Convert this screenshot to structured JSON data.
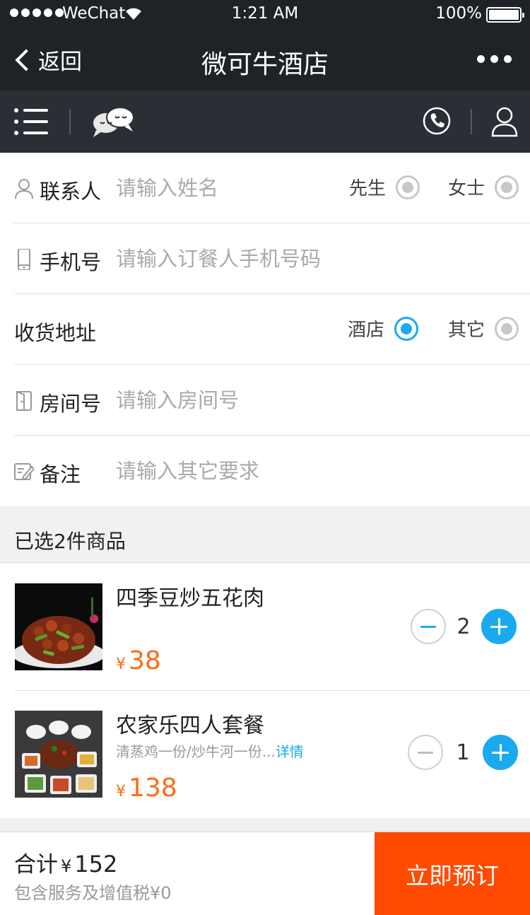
{
  "status_bar": {
    "carrier": "WeChat",
    "time": "1:21 AM",
    "battery": "100%"
  },
  "nav": {
    "back_label": "返回",
    "title": "微可牛酒店"
  },
  "form": {
    "contact": {
      "label": "联系人",
      "placeholder": "请输入姓名",
      "options": [
        "先生",
        "女士"
      ]
    },
    "phone": {
      "label": "手机号",
      "placeholder": "请输入订餐人手机号码"
    },
    "address": {
      "label": "收货地址",
      "options": [
        "酒店",
        "其它"
      ],
      "selected": "酒店"
    },
    "room": {
      "label": "房间号",
      "placeholder": "请输入房间号"
    },
    "note": {
      "label": "备注",
      "placeholder": "请输入其它要求"
    }
  },
  "selected_header": "已选2件商品",
  "items": [
    {
      "name": "四季豆炒五花肉",
      "desc": "",
      "desc_more": "",
      "currency": "¥",
      "price": "38",
      "qty": "2"
    },
    {
      "name": "农家乐四人套餐",
      "desc": "清蒸鸡一份/炒牛河一份...",
      "desc_more": "详情",
      "currency": "¥",
      "price": "138",
      "qty": "1"
    }
  ],
  "footer": {
    "total_label": "合计",
    "currency": "¥",
    "total": "152",
    "tax_note": "包含服务及增值税",
    "tax_value": "0",
    "submit_label": "立即预订"
  },
  "colors": {
    "accent": "#19aaf0",
    "price": "#ff6a14",
    "submit": "#ff4a00",
    "header": "#1f2226",
    "toolbar": "#2b2f35"
  },
  "icons": [
    "menu-icon",
    "chat-bubbles-icon",
    "phone-icon",
    "user-icon",
    "person-icon",
    "mobile-phone-icon",
    "door-icon",
    "edit-icon",
    "chevron-left-icon",
    "more-dots-icon",
    "wifi-icon",
    "battery-icon"
  ]
}
